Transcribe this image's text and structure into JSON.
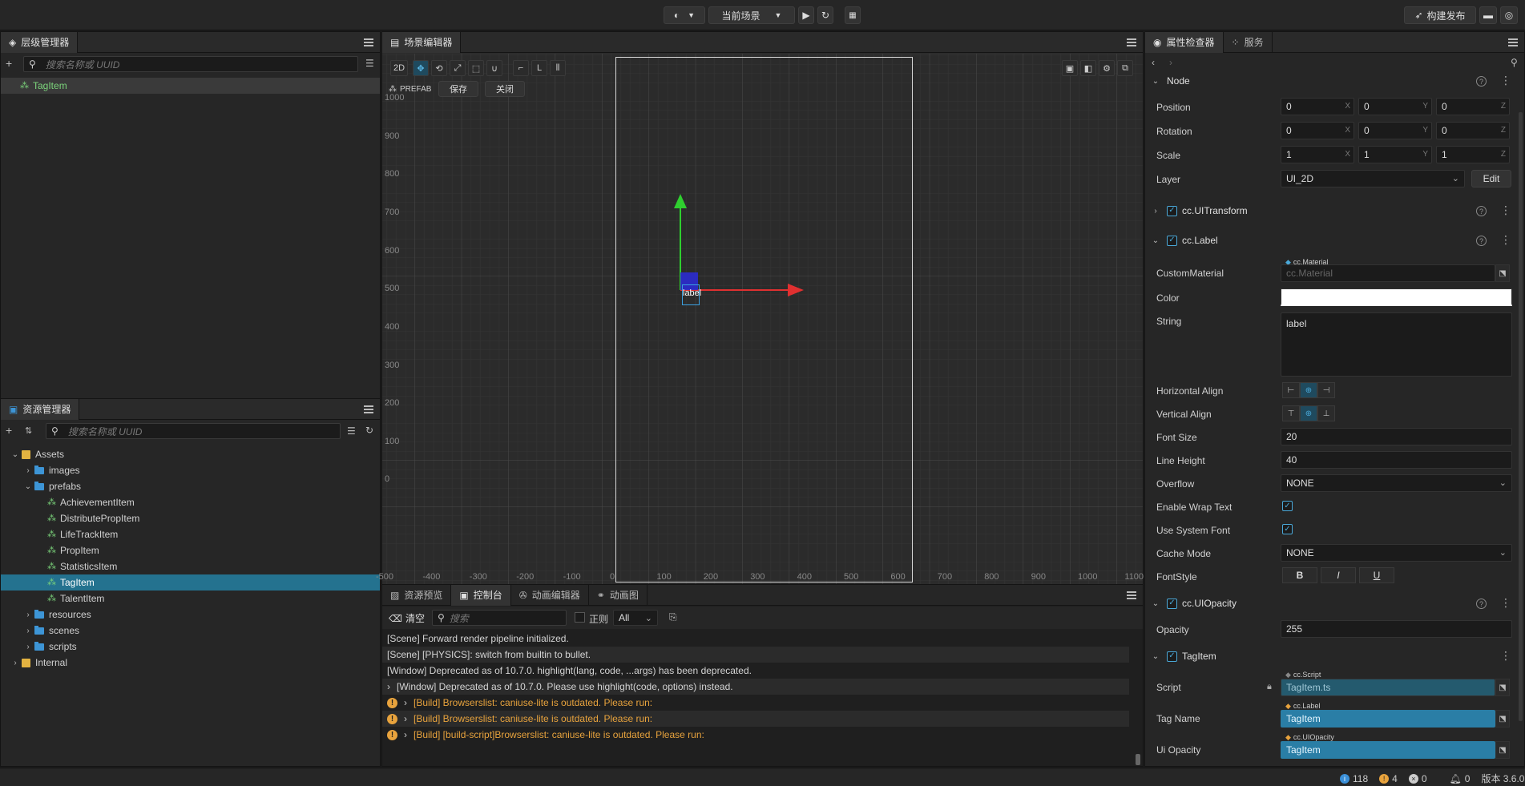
{
  "topbar": {
    "scene_select": "当前场景",
    "build_label": "构建发布"
  },
  "hierarchy": {
    "tab_label": "层级管理器",
    "search_placeholder": "搜索名称或 UUID",
    "root_node": "TagItem"
  },
  "assets": {
    "tab_label": "资源管理器",
    "search_placeholder": "搜索名称或 UUID",
    "tree": [
      {
        "label": "Assets",
        "level": 0,
        "kind": "db",
        "expanded": true
      },
      {
        "label": "images",
        "level": 1,
        "kind": "folder",
        "expanded": false
      },
      {
        "label": "prefabs",
        "level": 1,
        "kind": "folder",
        "expanded": true
      },
      {
        "label": "AchievementItem",
        "level": 2,
        "kind": "prefab"
      },
      {
        "label": "DistributePropItem",
        "level": 2,
        "kind": "prefab"
      },
      {
        "label": "LifeTrackItem",
        "level": 2,
        "kind": "prefab"
      },
      {
        "label": "PropItem",
        "level": 2,
        "kind": "prefab"
      },
      {
        "label": "StatisticsItem",
        "level": 2,
        "kind": "prefab"
      },
      {
        "label": "TagItem",
        "level": 2,
        "kind": "prefab",
        "selected": true
      },
      {
        "label": "TalentItem",
        "level": 2,
        "kind": "prefab"
      },
      {
        "label": "resources",
        "level": 1,
        "kind": "folder",
        "expanded": false
      },
      {
        "label": "scenes",
        "level": 1,
        "kind": "folder",
        "expanded": false
      },
      {
        "label": "scripts",
        "level": 1,
        "kind": "folder",
        "expanded": false
      },
      {
        "label": "Internal",
        "level": 0,
        "kind": "db",
        "expanded": false
      }
    ]
  },
  "scene": {
    "tab_label": "场景编辑器",
    "mode_2d": "2D",
    "prefab_label": "PREFAB",
    "save_label": "保存",
    "close_label": "关闭",
    "label_text": "label",
    "y_ticks": [
      "1000",
      "900",
      "800",
      "700",
      "600",
      "500",
      "400",
      "300",
      "200",
      "100",
      "0"
    ],
    "x_ticks": [
      "-500",
      "-400",
      "-300",
      "-200",
      "-100",
      "0",
      "100",
      "200",
      "300",
      "400",
      "500",
      "600",
      "700",
      "800",
      "900",
      "1000",
      "1100"
    ]
  },
  "bottom": {
    "tabs": [
      "资源预览",
      "控制台",
      "动画编辑器",
      "动画图"
    ],
    "active_tab": "控制台",
    "clear_label": "清空",
    "search_placeholder": "搜索",
    "regex_label": "正则",
    "filter_value": "All",
    "logs": [
      {
        "text": "[Scene] Forward render pipeline initialized.",
        "kind": "info"
      },
      {
        "text": "[Scene] [PHYSICS]: switch from builtin to bullet.",
        "kind": "info"
      },
      {
        "text": "[Window] Deprecated as of 10.7.0. highlight(lang, code, ...args) has been deprecated.",
        "kind": "info"
      },
      {
        "text": "[Window] Deprecated as of 10.7.0. Please use highlight(code, options) instead.",
        "kind": "info-expand"
      },
      {
        "text": "[Build] Browserslist: caniuse-lite is outdated. Please run:",
        "kind": "warn"
      },
      {
        "text": "[Build] Browserslist: caniuse-lite is outdated. Please run:",
        "kind": "warn"
      },
      {
        "text": "[Build] [build-script]Browserslist: caniuse-lite is outdated. Please run:",
        "kind": "warn"
      }
    ]
  },
  "inspector": {
    "tab_label": "属性检查器",
    "services_label": "服务",
    "node": {
      "header": "Node",
      "position_label": "Position",
      "rotation_label": "Rotation",
      "scale_label": "Scale",
      "layer_label": "Layer",
      "position": [
        "0",
        "0",
        "0"
      ],
      "rotation": [
        "0",
        "0",
        "0"
      ],
      "scale": [
        "1",
        "1",
        "1"
      ],
      "layer_value": "UI_2D",
      "edit_label": "Edit",
      "axis_x": "X",
      "axis_y": "Y",
      "axis_z": "Z"
    },
    "uitransform": "cc.UITransform",
    "label_comp": {
      "header": "cc.Label",
      "custom_material_label": "CustomMaterial",
      "material_tag": "cc.Material",
      "material_value": "cc.Material",
      "color_label": "Color",
      "string_label": "String",
      "string_value": "label",
      "halign_label": "Horizontal Align",
      "valign_label": "Vertical Align",
      "font_size_label": "Font Size",
      "font_size": "20",
      "line_height_label": "Line Height",
      "line_height": "40",
      "overflow_label": "Overflow",
      "overflow_value": "NONE",
      "wrap_label": "Enable Wrap Text",
      "system_font_label": "Use System Font",
      "cache_label": "Cache Mode",
      "cache_value": "NONE",
      "fontstyle_label": "FontStyle",
      "bold": "B",
      "italic": "I",
      "underline": "U"
    },
    "opacity_comp": {
      "header": "cc.UIOpacity",
      "opacity_label": "Opacity",
      "opacity_value": "255"
    },
    "tagitem_comp": {
      "header": "TagItem",
      "script_label": "Script",
      "script_tag": "cc.Script",
      "script_value": "TagItem.ts",
      "tagname_label": "Tag Name",
      "tagname_tag": "cc.Label",
      "tagname_value": "TagItem",
      "uiopacity_label": "Ui Opacity",
      "uiopacity_tag": "cc.UIOpacity",
      "uiopacity_value": "TagItem"
    }
  },
  "status": {
    "info_count": "118",
    "warn_count": "4",
    "error_count": "0",
    "notif_count": "0",
    "version": "版本 3.6.0"
  }
}
